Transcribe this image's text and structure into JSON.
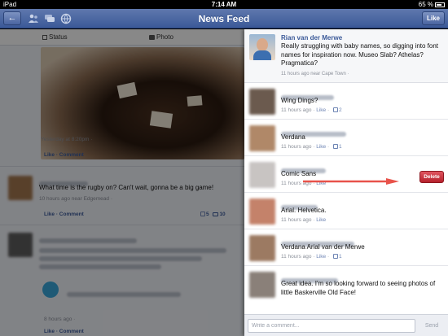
{
  "statusbar": {
    "carrier": "iPad",
    "time": "7:14 AM",
    "battery": "65 %"
  },
  "navbar": {
    "title": "News Feed",
    "like_label": "Like",
    "back_glyph": "←"
  },
  "feed": {
    "tabs": [
      {
        "label": "Status"
      },
      {
        "label": "Photo"
      }
    ],
    "photo_post": {
      "timestamp": "Yesterday at 8:20pm ·",
      "like": "Like",
      "comment": "Comment"
    },
    "post2": {
      "text": "What time is the rugby on? Can't wait, gonna be a big game!",
      "meta": "10 hours ago near Edgemead ·",
      "like": "Like",
      "comment": "Comment",
      "likes_count": "5",
      "comments_count": "10"
    },
    "post3": {
      "meta": "8 hours ago ·",
      "like": "Like",
      "comment": "Comment"
    }
  },
  "panel": {
    "op": {
      "author": "Rian van der Merwe",
      "text": "Really struggling with baby names, so digging into font names for inspiration now. Museo Slab? Athelas? Pragmatica?",
      "meta": "11 hours ago near Cape Town ·"
    },
    "comments": [
      {
        "text": "Wing Dings?",
        "time": "11 hours ago",
        "like": "Like",
        "likes": "2"
      },
      {
        "text": "Verdana",
        "time": "11 hours ago",
        "like": "Like",
        "likes": "1"
      },
      {
        "text": "Comic Sans",
        "time": "11 hours ago",
        "like": "Like",
        "likes": ""
      },
      {
        "text": "Arial. Helvetica.",
        "time": "11 hours ago",
        "like": "Like",
        "likes": ""
      },
      {
        "text": "Verdana Arial van der Merwe",
        "time": "11 hours ago",
        "like": "Like",
        "likes": "1"
      },
      {
        "text": "Great idea. I'm so looking forward to seeing photos of little Baskerville Old Face!",
        "time": "",
        "like": "",
        "likes": ""
      }
    ],
    "delete_label": "Delete",
    "composer": {
      "placeholder": "Write a comment...",
      "send_label": "Send"
    }
  },
  "colors": {
    "brand": "#3b5998",
    "delete": "#c8283a",
    "arrow": "#e8524a"
  }
}
